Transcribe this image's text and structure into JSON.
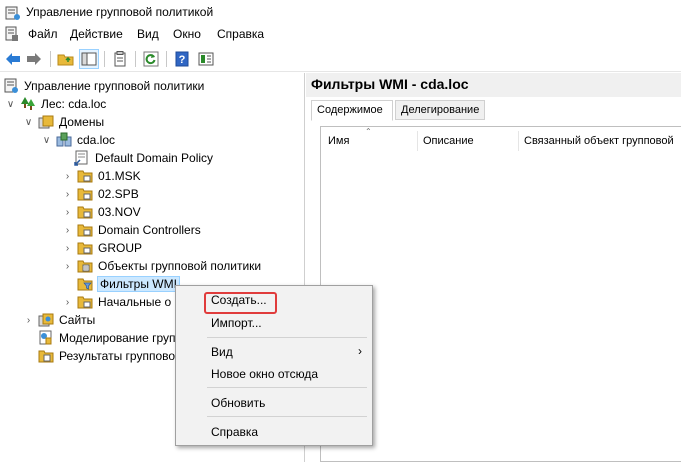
{
  "window": {
    "title": "Управление групповой политикой",
    "app_icon": "gpmc-icon"
  },
  "menu": {
    "items": [
      "Файл",
      "Действие",
      "Вид",
      "Окно",
      "Справка"
    ]
  },
  "toolbar": {
    "buttons": [
      "back-arrow-icon",
      "forward-arrow-icon",
      "folder-up-icon",
      "show-tree-icon",
      "properties-icon",
      "refresh-icon",
      "help-icon",
      "console-icon"
    ]
  },
  "tree": {
    "items": [
      {
        "label": "Управление групповой политики"
      },
      {
        "label": "Лес: cda.loc"
      },
      {
        "label": "Домены"
      },
      {
        "label": "cda.loc"
      },
      {
        "label": "Default Domain Policy"
      },
      {
        "label": "01.MSK"
      },
      {
        "label": "02.SPB"
      },
      {
        "label": "03.NOV"
      },
      {
        "label": "Domain Controllers"
      },
      {
        "label": "GROUP"
      },
      {
        "label": "Объекты групповой политики"
      },
      {
        "label": "Фильтры WMI"
      },
      {
        "label": "Начальные о"
      },
      {
        "label": "Сайты"
      },
      {
        "label": "Моделирование групп"
      },
      {
        "label": "Результаты группово"
      }
    ]
  },
  "right": {
    "title": "Фильтры WMI - cda.loc",
    "tabs": [
      "Содержимое",
      "Делегирование"
    ],
    "columns": [
      "Имя",
      "Описание",
      "Связанный объект групповой"
    ]
  },
  "context_menu": {
    "items": [
      "Создать...",
      "Импорт...",
      "Вид",
      "Новое окно отсюда",
      "Обновить",
      "Справка"
    ]
  },
  "colors": {
    "selection": "#cce8ff",
    "highlight_box": "#e03c3c",
    "folder": "#e8b93a"
  }
}
